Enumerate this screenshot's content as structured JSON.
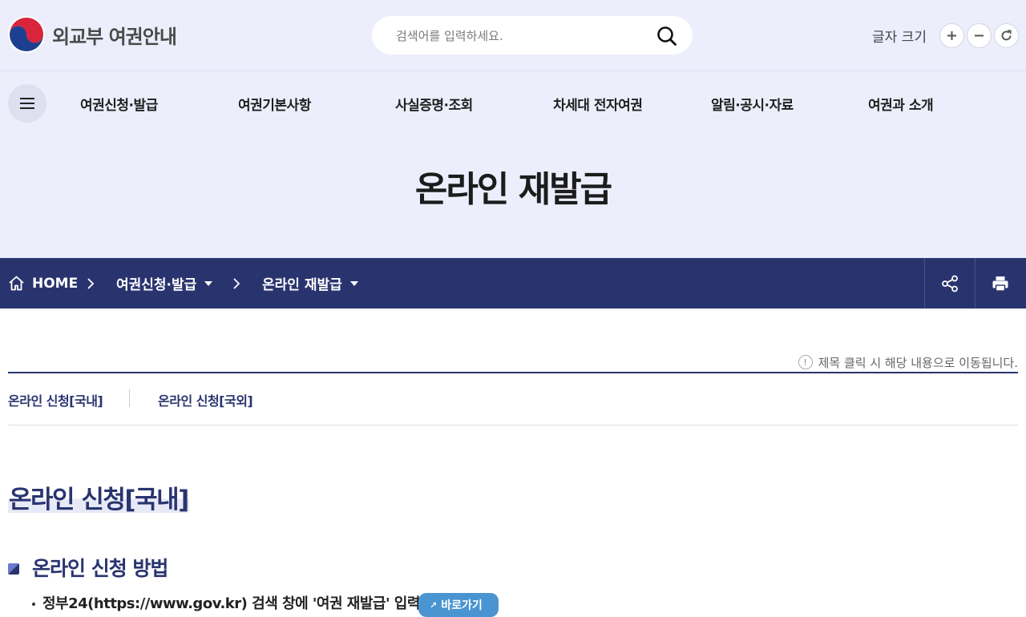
{
  "header": {
    "logo_text": "외교부 여권안내",
    "search": {
      "placeholder": "검색어를 입력하세요."
    },
    "font_size": {
      "label": "글자 크기",
      "increase": "+",
      "decrease": "−",
      "reset": "↻"
    }
  },
  "gnb": {
    "items": [
      "여권신청·발급",
      "여권기본사항",
      "사실증명·조회",
      "차세대 전자여권",
      "알림·공시·자료",
      "여권과 소개"
    ]
  },
  "page_title": "온라인 재발급",
  "breadcrumb": {
    "home": "HOME",
    "level1": "여권신청·발급",
    "level2": "온라인 재발급"
  },
  "content": {
    "notice": "제목 클릭 시 해당 내용으로 이동됩니다.",
    "anchors": [
      "온라인 신청[국내]",
      "온라인 신청[국외]"
    ],
    "section_title": "온라인 신청[국내]",
    "subsection_title": "온라인 신청 방법",
    "step1": "정부24(https://www.gov.kr) 검색 창에 '여권 재발급' 입력",
    "go_button": "바로가기"
  },
  "colors": {
    "header_bg": "#eceefc",
    "navy": "#29346f",
    "link_blue": "#4a95d1"
  }
}
